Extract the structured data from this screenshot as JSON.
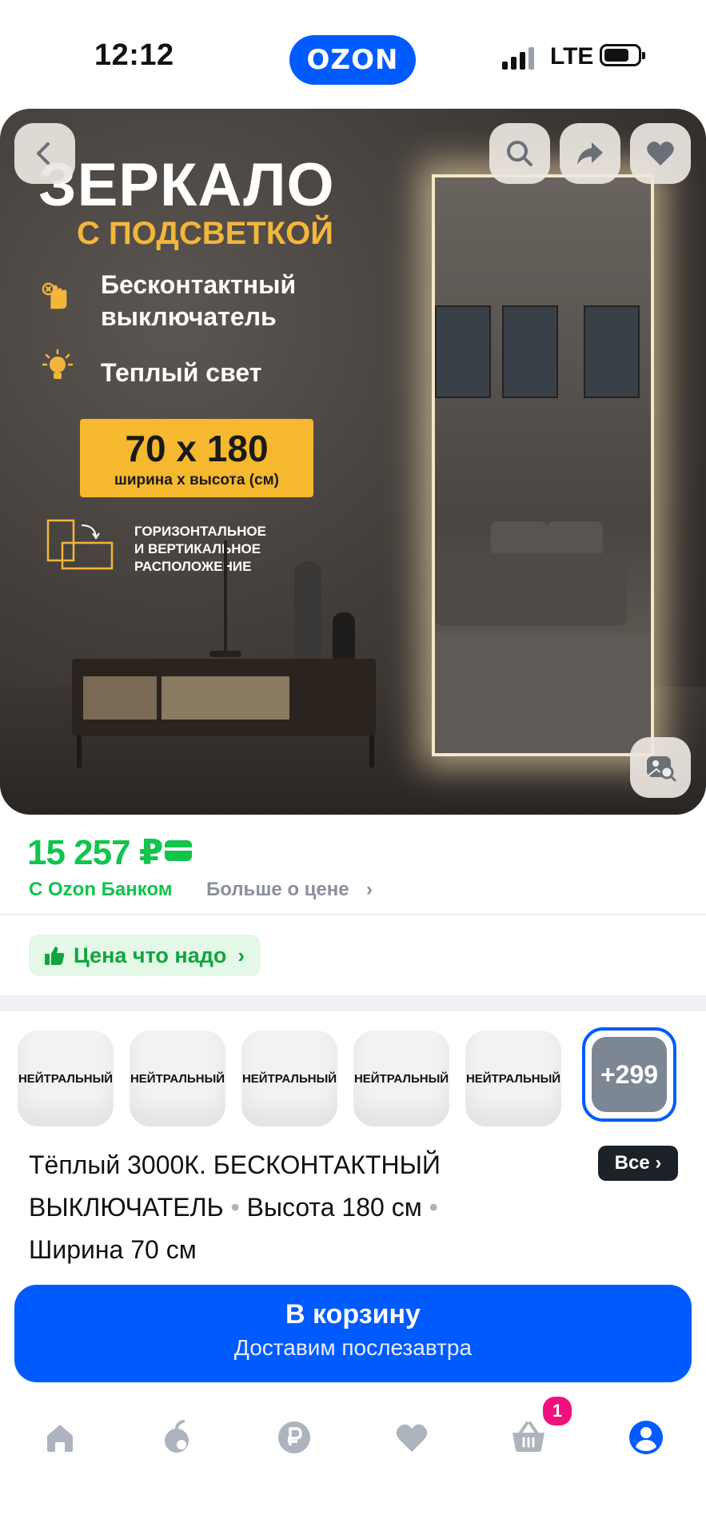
{
  "status_bar": {
    "time": "12:12",
    "network": "LTE"
  },
  "logo": {
    "text": "OZON"
  },
  "hero": {
    "title": "ЗЕРКАЛО",
    "subtitle": "С ПОДСВЕТКОЙ",
    "feature_1_line1": "Бесконтактный",
    "feature_1_line2": "выключатель",
    "feature_2": "Теплый свет",
    "size_main": "70 x 180",
    "size_sub": "ширина х высота (см)",
    "orientation_line1": "ГОРИЗОНТАЛЬНОЕ",
    "orientation_line2": "И ВЕРТИКАЛЬНОЕ",
    "orientation_line3": "РАСПОЛОЖЕНИЕ",
    "icons": [
      "back-icon",
      "search-icon",
      "share-icon",
      "heart-icon",
      "visual-search-icon"
    ]
  },
  "price": {
    "value": "15 257 ₽",
    "bank_label": "С Ozon Банком",
    "more_label": "Больше о цене",
    "chevron": "›"
  },
  "promo": {
    "label": "Цена что надо",
    "chevron": "›"
  },
  "variants": {
    "swatches": [
      "НЕЙТРАЛЬНЫЙ",
      "НЕЙТРАЛЬНЫЙ",
      "НЕЙТРАЛЬНЫЙ",
      "НЕЙТРАЛЬНЫЙ",
      "НЕЙТРАЛЬНЫЙ"
    ],
    "more_count": "+299",
    "selected_part1": "Тёплый 3000К. БЕСКОНТАКТНЫЙ",
    "selected_part2": "ВЫКЛЮЧАТЕЛЬ",
    "separator": "•",
    "selected_part3": "Высота 180 см",
    "selected_part4": "Ширина 70 см",
    "all_label": "Все",
    "all_chevron": "›"
  },
  "cart": {
    "label": "В корзину",
    "sublabel": "Доставим послезавтра"
  },
  "tabbar": {
    "items": [
      "home-icon",
      "fresh-icon",
      "finance-icon",
      "favorites-icon",
      "cart-icon",
      "profile-icon"
    ],
    "cart_badge": "1"
  },
  "colors": {
    "brand": "#005bff",
    "price_green": "#10c44c",
    "badge": "#f1117e"
  }
}
